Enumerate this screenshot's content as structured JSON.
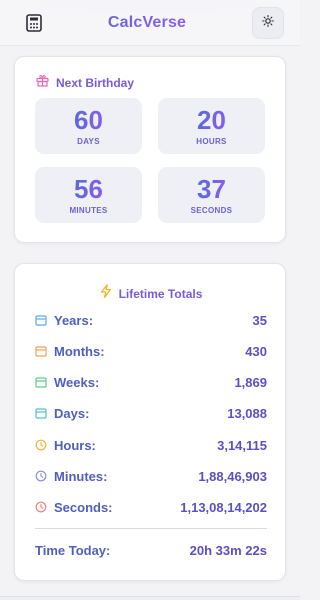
{
  "app": {
    "title": "CalcVerse"
  },
  "icons": {
    "menu": "calculator-icon",
    "theme": "sun-icon",
    "birthday": "gift-icon",
    "lifetime": "lightning-icon"
  },
  "colors": {
    "accent": "#7b5ad8",
    "text": "#4f5fbf",
    "value": "#5b4fc8",
    "tile_bg": "#eef0f6"
  },
  "birthday": {
    "title": "Next Birthday",
    "tiles": [
      {
        "value": "60",
        "unit": "DAYS"
      },
      {
        "value": "20",
        "unit": "HOURS"
      },
      {
        "value": "56",
        "unit": "MINUTES"
      },
      {
        "value": "37",
        "unit": "SECONDS"
      }
    ]
  },
  "lifetime": {
    "title": "Lifetime Totals",
    "rows": [
      {
        "label": "Years:",
        "value": "35",
        "icon": "calendar-icon",
        "color": "#5aa9e6"
      },
      {
        "label": "Months:",
        "value": "430",
        "icon": "calendar-icon",
        "color": "#f0a05a"
      },
      {
        "label": "Weeks:",
        "value": "1,869",
        "icon": "calendar-icon",
        "color": "#5cc98a"
      },
      {
        "label": "Days:",
        "value": "13,088",
        "icon": "calendar-icon",
        "color": "#4fc1c9"
      },
      {
        "label": "Hours:",
        "value": "3,14,115",
        "icon": "clock-icon",
        "color": "#f2b33a"
      },
      {
        "label": "Minutes:",
        "value": "1,88,46,903",
        "icon": "clock-icon",
        "color": "#8a8fe0"
      },
      {
        "label": "Seconds:",
        "value": "1,13,08,14,202",
        "icon": "clock-icon",
        "color": "#ef7f7f"
      }
    ],
    "today": {
      "label": "Time Today:",
      "value": "20h 33m 22s"
    }
  }
}
